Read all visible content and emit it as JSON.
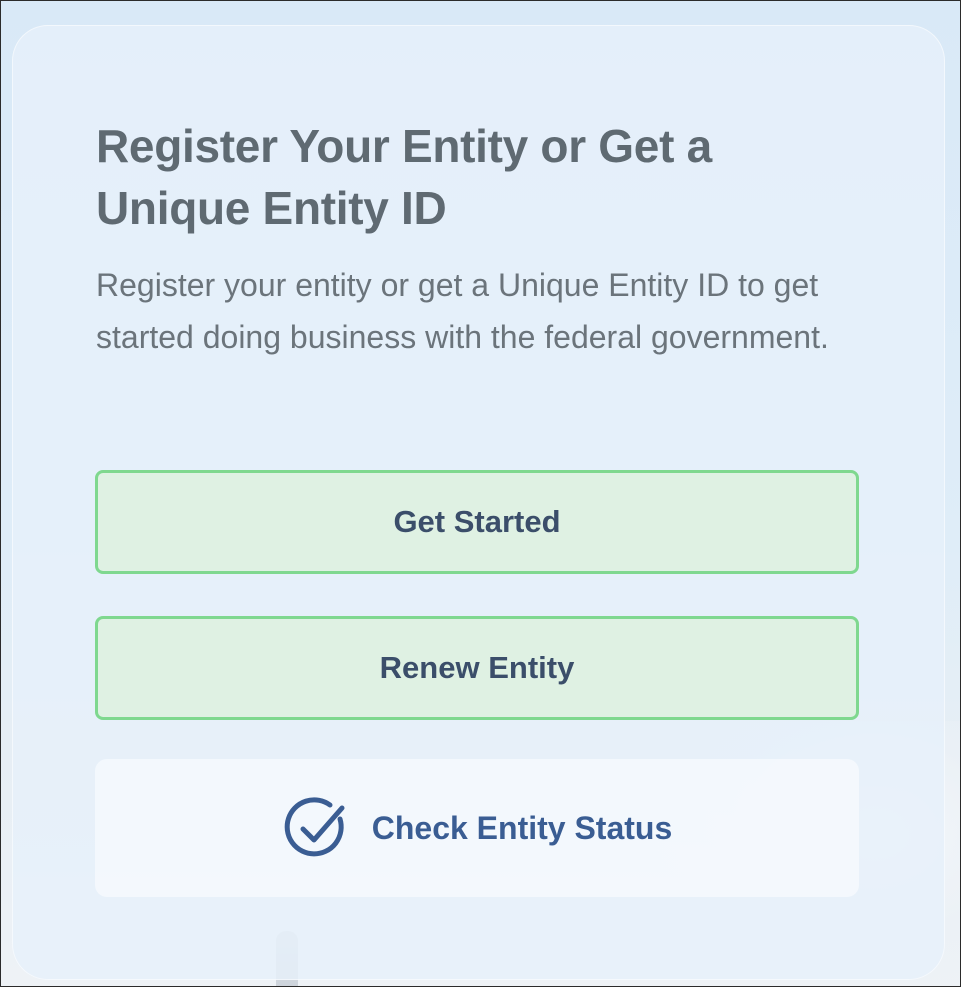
{
  "card": {
    "title": "Register Your Entity or Get a Unique Entity ID",
    "description": "Register your entity or get a Unique Entity ID to get started doing business with the federal government."
  },
  "buttons": {
    "get_started": "Get Started",
    "renew_entity": "Renew Entity",
    "check_status": "Check Entity Status"
  },
  "icons": {
    "check_status_icon": "check-circle-icon"
  },
  "colors": {
    "title_text": "#5f6a72",
    "button_text": "#3b4e6a",
    "button_fill": "#dff1e3",
    "button_border": "#7fd88f",
    "status_link": "#3a5d93"
  }
}
